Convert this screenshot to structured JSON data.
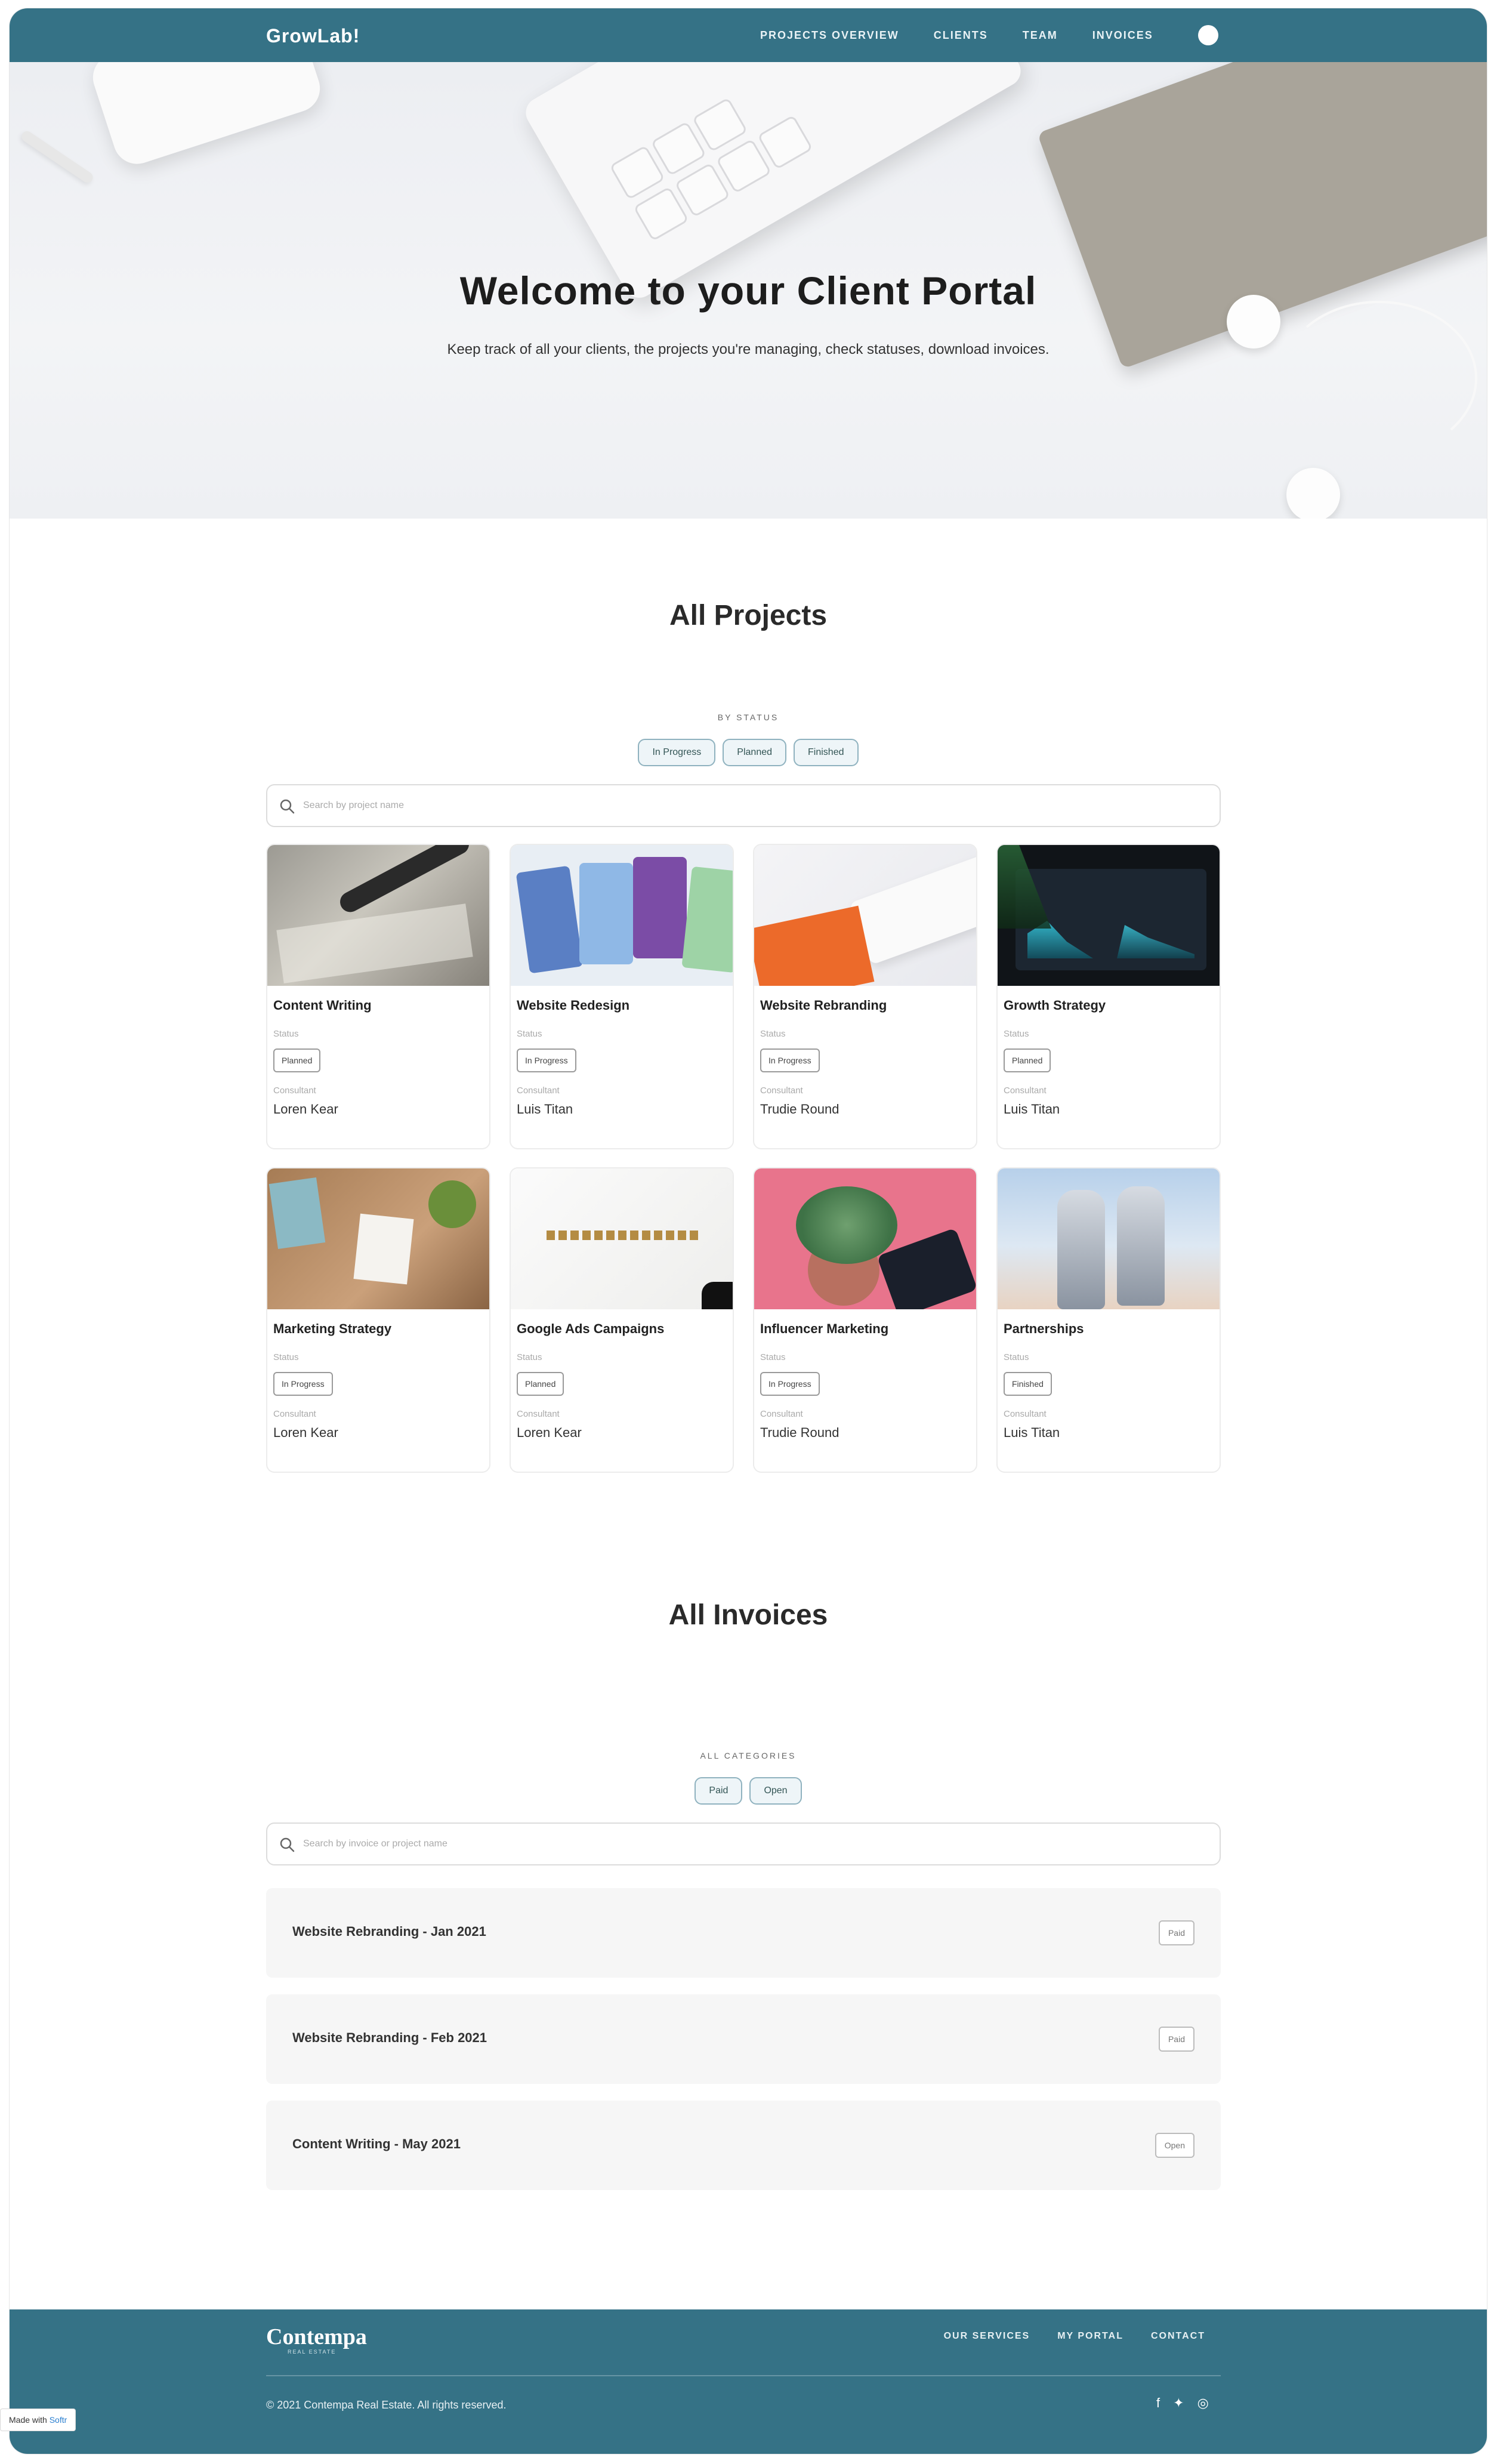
{
  "header": {
    "logo": "GrowLab!",
    "nav": [
      "PROJECTS OVERVIEW",
      "CLIENTS",
      "TEAM",
      "INVOICES"
    ]
  },
  "hero": {
    "title": "Welcome to your Client Portal",
    "subtitle": "Keep track of all your clients, the projects you're managing, check statuses, download invoices."
  },
  "projects": {
    "title": "All Projects",
    "filter_label": "BY STATUS",
    "filters": [
      "In Progress",
      "Planned",
      "Finished"
    ],
    "search_placeholder": "Search by project name",
    "status_label": "Status",
    "consultant_label": "Consultant",
    "items": [
      {
        "title": "Content Writing",
        "status": "Planned",
        "consultant": "Loren Kear"
      },
      {
        "title": "Website Redesign",
        "status": "In Progress",
        "consultant": "Luis Titan"
      },
      {
        "title": "Website Rebranding",
        "status": "In Progress",
        "consultant": "Trudie Round"
      },
      {
        "title": "Growth Strategy",
        "status": "Planned",
        "consultant": "Luis Titan"
      },
      {
        "title": "Marketing Strategy",
        "status": "In Progress",
        "consultant": "Loren Kear"
      },
      {
        "title": "Google Ads Campaigns",
        "status": "Planned",
        "consultant": "Loren Kear"
      },
      {
        "title": "Influencer Marketing",
        "status": "In Progress",
        "consultant": "Trudie Round"
      },
      {
        "title": "Partnerships",
        "status": "Finished",
        "consultant": "Luis Titan"
      }
    ]
  },
  "invoices": {
    "title": "All Invoices",
    "filter_label": "ALL CATEGORIES",
    "filters": [
      "Paid",
      "Open"
    ],
    "search_placeholder": "Search by invoice or project name",
    "items": [
      {
        "name": "Website Rebranding - Jan 2021",
        "status": "Paid"
      },
      {
        "name": "Website Rebranding - Feb 2021",
        "status": "Paid"
      },
      {
        "name": "Content Writing - May 2021",
        "status": "Open"
      }
    ]
  },
  "footer": {
    "logo": "Contempa",
    "logo_sub": "REAL ESTATE",
    "nav": [
      "OUR SERVICES",
      "MY PORTAL",
      "CONTACT"
    ],
    "copyright": "© 2021 Contempa Real Estate. All rights reserved.",
    "social": [
      "f",
      "t",
      "ig"
    ]
  },
  "cookie": {
    "text": "Made with ",
    "link": "Softr"
  },
  "colors": {
    "brand": "#357286",
    "chip_bg": "#eef5f8",
    "chip_border": "#8fb2bf",
    "invoice_bg": "#f6f6f6"
  },
  "icons": [
    "avatar",
    "search-icon",
    "facebook-icon",
    "twitter-icon",
    "instagram-icon"
  ]
}
